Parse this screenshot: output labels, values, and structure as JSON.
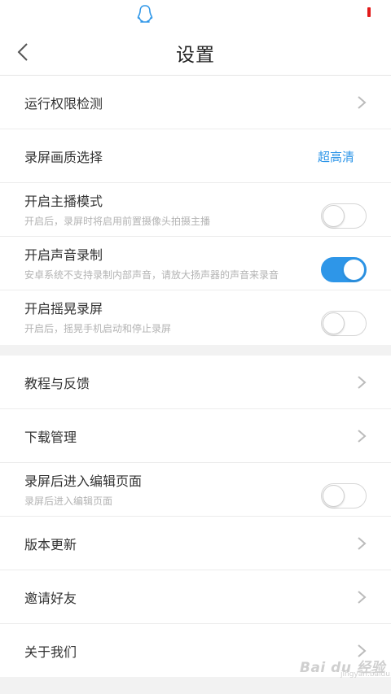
{
  "status_bar": {
    "app_icon": "qq-penguin-icon",
    "battery_color": "#e21b1b"
  },
  "header": {
    "title": "设置",
    "back_icon": "chevron-left-icon"
  },
  "accent_color": "#2e96e8",
  "section1": [
    {
      "label": "运行权限检测",
      "type": "link"
    },
    {
      "label": "录屏画质选择",
      "type": "value",
      "value": "超高清"
    },
    {
      "label": "开启主播模式",
      "subtitle": "开启后，录屏时将启用前置摄像头拍摄主播",
      "type": "toggle",
      "on": false
    },
    {
      "label": "开启声音录制",
      "subtitle": "安卓系统不支持录制内部声音，请放大扬声器的声音来录音",
      "type": "toggle",
      "on": true
    },
    {
      "label": "开启摇晃录屏",
      "subtitle": "开启后，摇晃手机启动和停止录屏",
      "type": "toggle",
      "on": false
    }
  ],
  "section2": [
    {
      "label": "教程与反馈",
      "type": "link"
    },
    {
      "label": "下载管理",
      "type": "link"
    },
    {
      "label": "录屏后进入编辑页面",
      "subtitle": "录屏后进入编辑页面",
      "type": "toggle",
      "on": false
    },
    {
      "label": "版本更新",
      "type": "link"
    },
    {
      "label": "邀请好友",
      "type": "link"
    },
    {
      "label": "关于我们",
      "type": "link"
    }
  ],
  "watermark": {
    "text": "Bai du 经验",
    "sub": "jingyan.baidu.com"
  }
}
